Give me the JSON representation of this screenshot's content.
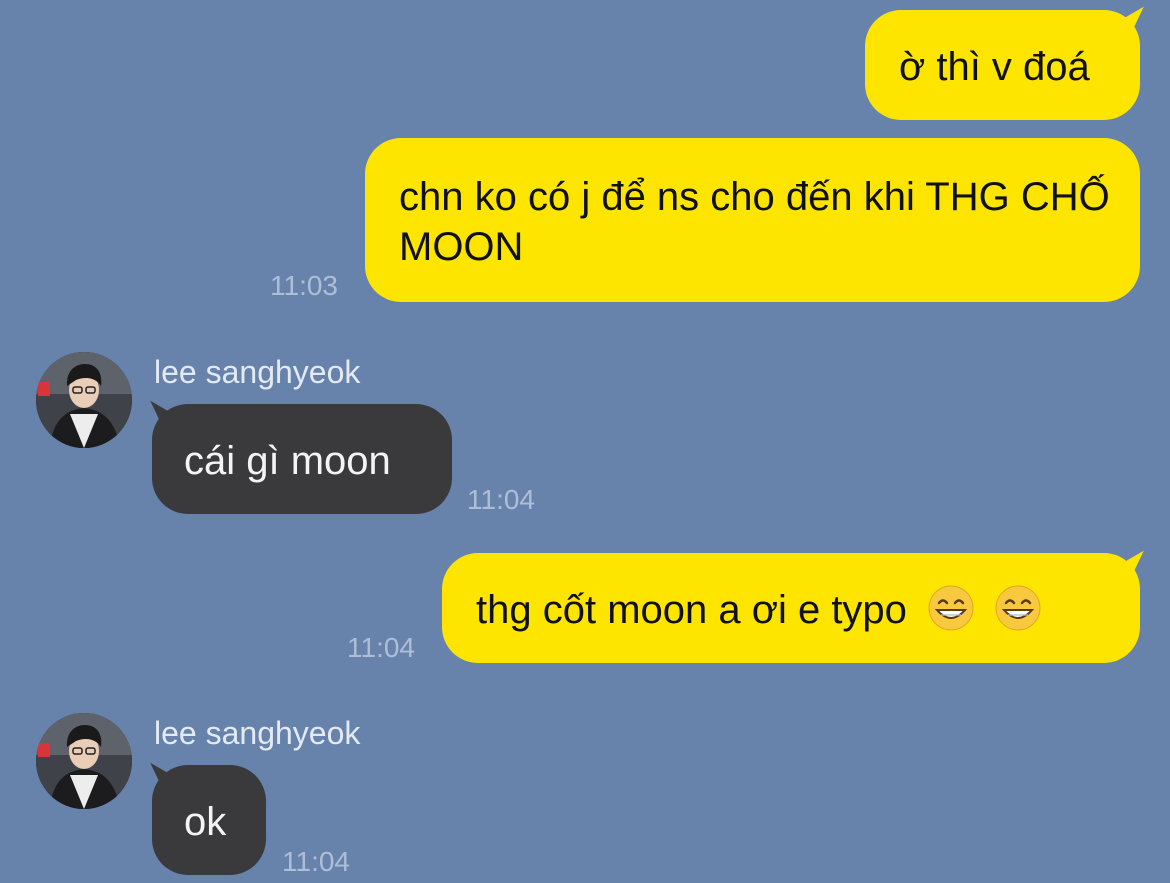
{
  "colors": {
    "background": "#6783AC",
    "outgoing_bubble": "#FEE500",
    "incoming_bubble": "#3A3A3C",
    "timestamp": "#AEBED6"
  },
  "messages": [
    {
      "direction": "outgoing",
      "text": "ờ thì v đoá",
      "time": ""
    },
    {
      "direction": "outgoing",
      "text": "chn ko có j để ns cho đến khi THG CHỐ MOON",
      "time": "11:03"
    },
    {
      "direction": "incoming",
      "sender": "lee sanghyeok",
      "text": "cái gì moon",
      "time": "11:04"
    },
    {
      "direction": "outgoing",
      "text": "thg cốt moon a ơi e typo",
      "emoji": [
        "grinning-face-with-smiling-eyes",
        "grinning-face-with-smiling-eyes"
      ],
      "time": "11:04"
    },
    {
      "direction": "incoming",
      "sender": "lee sanghyeok",
      "text": "ok",
      "time": "11:04"
    }
  ]
}
